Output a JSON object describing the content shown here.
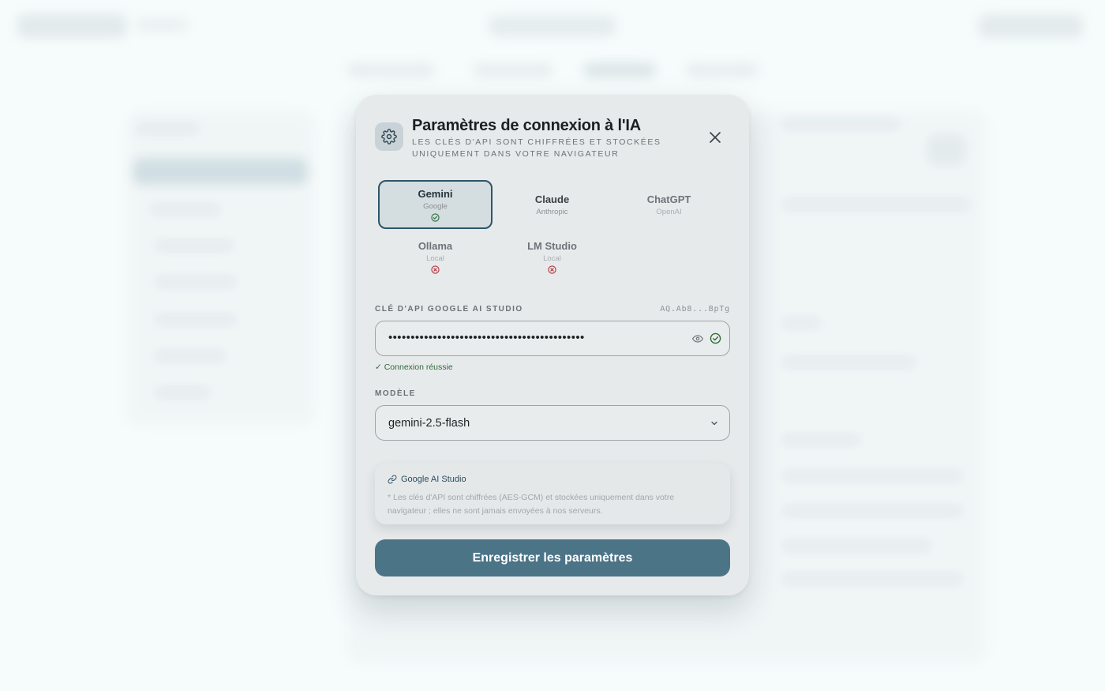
{
  "dialog": {
    "title": "Paramètres de connexion à l'IA",
    "subtitle": "Les clés d'API sont chiffrées et stockées uniquement dans votre navigateur",
    "icon": "gear-icon"
  },
  "providers": [
    {
      "name": "Gemini",
      "vendor": "Google",
      "status": "connected",
      "selected": true
    },
    {
      "name": "Claude",
      "vendor": "Anthropic",
      "status": "none",
      "selected": false
    },
    {
      "name": "ChatGPT",
      "vendor": "OpenAI",
      "status": "none",
      "selected": false
    },
    {
      "name": "Ollama",
      "vendor": "Local",
      "status": "error",
      "selected": false
    },
    {
      "name": "LM Studio",
      "vendor": "Local",
      "status": "error",
      "selected": false
    }
  ],
  "api_key": {
    "label": "Clé d'API Google AI Studio",
    "masked_hint": "AQ.Ab8...BpTg",
    "value": "••••••••••••••••••••••••••••••••••••••••••••",
    "success_message": "✓ Connexion réussie"
  },
  "model": {
    "label": "Modèle",
    "selected": "gemini-2.5-flash"
  },
  "info": {
    "link_label": "Google AI Studio",
    "note": "* Les clés d'API sont chiffrées (AES-GCM) et stockées uniquement dans votre navigateur ; elles ne sont jamais envoyées à nos serveurs."
  },
  "save_label": "Enregistrer les paramètres",
  "colors": {
    "accent": "#4b7487",
    "selected_border": "#2e5468",
    "success": "#2e6b3a",
    "error": "#b2303a"
  }
}
